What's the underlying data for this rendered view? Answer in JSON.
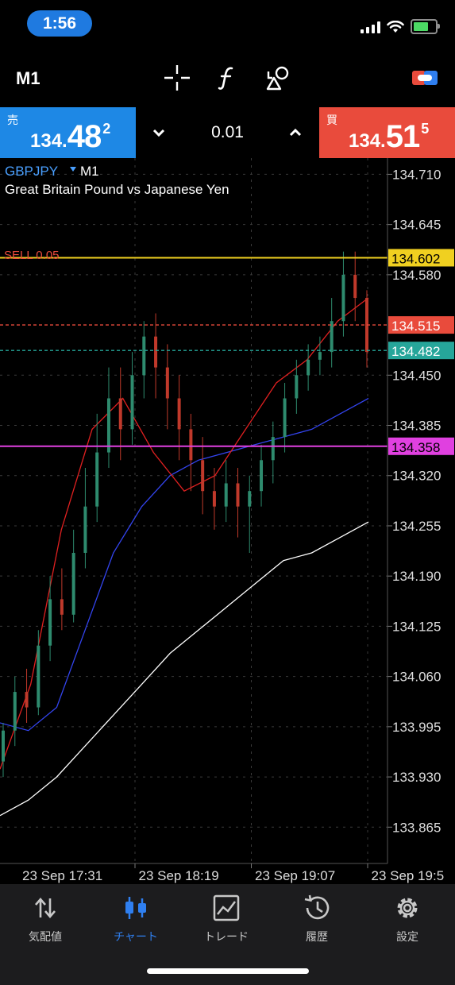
{
  "status_bar": {
    "time": "1:56",
    "battery_color": "#4cd964"
  },
  "toolbar": {
    "timeframe": "M1",
    "icons": [
      "crosshair-icon",
      "function-icon",
      "objects-icon",
      "account-switch-icon"
    ]
  },
  "trade_bar": {
    "sell": {
      "label": "売",
      "prefix": "134.",
      "big": "48",
      "sup": "2",
      "color": "#1e88e5"
    },
    "buy": {
      "label": "買",
      "prefix": "134.",
      "big": "51",
      "sup": "5",
      "color": "#e94b3c"
    },
    "lot": "0.01"
  },
  "chart": {
    "symbol": "GBPJPY",
    "timeframe": "M1",
    "description": "Great Britain Pound vs Japanese Yen",
    "order_label": "SELL 0.05",
    "price_labels": [
      "134.710",
      "134.645",
      "134.580",
      "134.450",
      "134.385",
      "134.320",
      "134.255",
      "134.190",
      "134.125",
      "134.060",
      "133.995",
      "133.930",
      "133.865"
    ],
    "time_labels": [
      "23 Sep 17:31",
      "23 Sep 18:19",
      "23 Sep 19:07",
      "23 Sep 19:5"
    ]
  },
  "chart_data": {
    "type": "line",
    "symbol": "GBPJPY",
    "ylim": [
      133.818,
      134.731
    ],
    "y_ticks": [
      134.71,
      134.645,
      134.58,
      134.45,
      134.385,
      134.32,
      134.255,
      134.19,
      134.125,
      134.06,
      133.995,
      133.93,
      133.865
    ],
    "x_ticks": [
      "23 Sep 17:31",
      "23 Sep 18:19",
      "23 Sep 19:07",
      "23 Sep 19:5"
    ],
    "levels": [
      {
        "name": "SELL 0.05",
        "value": 134.602,
        "label": "134.602",
        "color": "#f0d020",
        "style": "solid",
        "label_text_color": "#000"
      },
      {
        "name": "ask",
        "value": 134.515,
        "label": "134.515",
        "color": "#e94b3c",
        "style": "dashed",
        "label_text_color": "#fff"
      },
      {
        "name": "bid",
        "value": 134.482,
        "label": "134.482",
        "color": "#26a69a",
        "style": "dashed",
        "label_text_color": "#fff"
      },
      {
        "name": "level",
        "value": 134.358,
        "label": "134.358",
        "color": "#e040e0",
        "style": "solid",
        "label_text_color": "#000"
      }
    ],
    "series": [
      {
        "color": "#ffffff",
        "values": [
          133.88,
          133.9,
          133.93,
          133.97,
          134.01,
          134.05,
          134.09,
          134.12,
          134.15,
          134.18,
          134.21,
          134.22,
          134.24,
          134.26
        ]
      },
      {
        "color": "#3344ee",
        "values": [
          134.0,
          133.99,
          134.02,
          134.12,
          134.22,
          134.28,
          134.32,
          134.34,
          134.35,
          134.36,
          134.37,
          134.38,
          134.4,
          134.42
        ]
      },
      {
        "color": "#e02020",
        "values": [
          133.94,
          134.05,
          134.25,
          134.38,
          134.42,
          134.35,
          134.3,
          134.32,
          134.38,
          134.44,
          134.47,
          134.52,
          134.55
        ]
      }
    ],
    "candles": [
      [
        133.95,
        133.99,
        133.93,
        134.0
      ],
      [
        133.99,
        134.04,
        133.97,
        134.06
      ],
      [
        134.04,
        134.02,
        134.0,
        134.07
      ],
      [
        134.02,
        134.1,
        134.01,
        134.12
      ],
      [
        134.1,
        134.16,
        134.08,
        134.19
      ],
      [
        134.16,
        134.14,
        134.12,
        134.2
      ],
      [
        134.14,
        134.22,
        134.13,
        134.25
      ],
      [
        134.22,
        134.28,
        134.2,
        134.33
      ],
      [
        134.28,
        134.35,
        134.26,
        134.4
      ],
      [
        134.35,
        134.42,
        134.33,
        134.46
      ],
      [
        134.42,
        134.38,
        134.34,
        134.46
      ],
      [
        134.38,
        134.45,
        134.36,
        134.48
      ],
      [
        134.45,
        134.5,
        134.42,
        134.52
      ],
      [
        134.5,
        134.46,
        134.42,
        134.53
      ],
      [
        134.46,
        134.42,
        134.38,
        134.49
      ],
      [
        134.42,
        134.38,
        134.34,
        134.45
      ],
      [
        134.38,
        134.34,
        134.3,
        134.4
      ],
      [
        134.34,
        134.3,
        134.27,
        134.37
      ],
      [
        134.3,
        134.28,
        134.25,
        134.33
      ],
      [
        134.28,
        134.31,
        134.26,
        134.34
      ],
      [
        134.31,
        134.28,
        134.24,
        134.33
      ],
      [
        134.28,
        134.3,
        134.22,
        134.32
      ],
      [
        134.3,
        134.34,
        134.28,
        134.36
      ],
      [
        134.34,
        134.37,
        134.31,
        134.39
      ],
      [
        134.37,
        134.42,
        134.35,
        134.44
      ],
      [
        134.42,
        134.45,
        134.4,
        134.47
      ],
      [
        134.45,
        134.47,
        134.43,
        134.49
      ],
      [
        134.47,
        134.48,
        134.45,
        134.5
      ],
      [
        134.48,
        134.52,
        134.46,
        134.55
      ],
      [
        134.52,
        134.58,
        134.5,
        134.61
      ],
      [
        134.58,
        134.55,
        134.52,
        134.61
      ],
      [
        134.55,
        134.48,
        134.46,
        134.56
      ]
    ]
  },
  "nav": {
    "items": [
      {
        "label": "気配値",
        "icon": "quotes-arrows-icon",
        "active": false
      },
      {
        "label": "チャート",
        "icon": "candlestick-chart-icon",
        "active": true
      },
      {
        "label": "トレード",
        "icon": "trade-chart-icon",
        "active": false
      },
      {
        "label": "履歴",
        "icon": "history-clock-icon",
        "active": false
      },
      {
        "label": "設定",
        "icon": "settings-gear-icon",
        "active": false
      }
    ]
  }
}
